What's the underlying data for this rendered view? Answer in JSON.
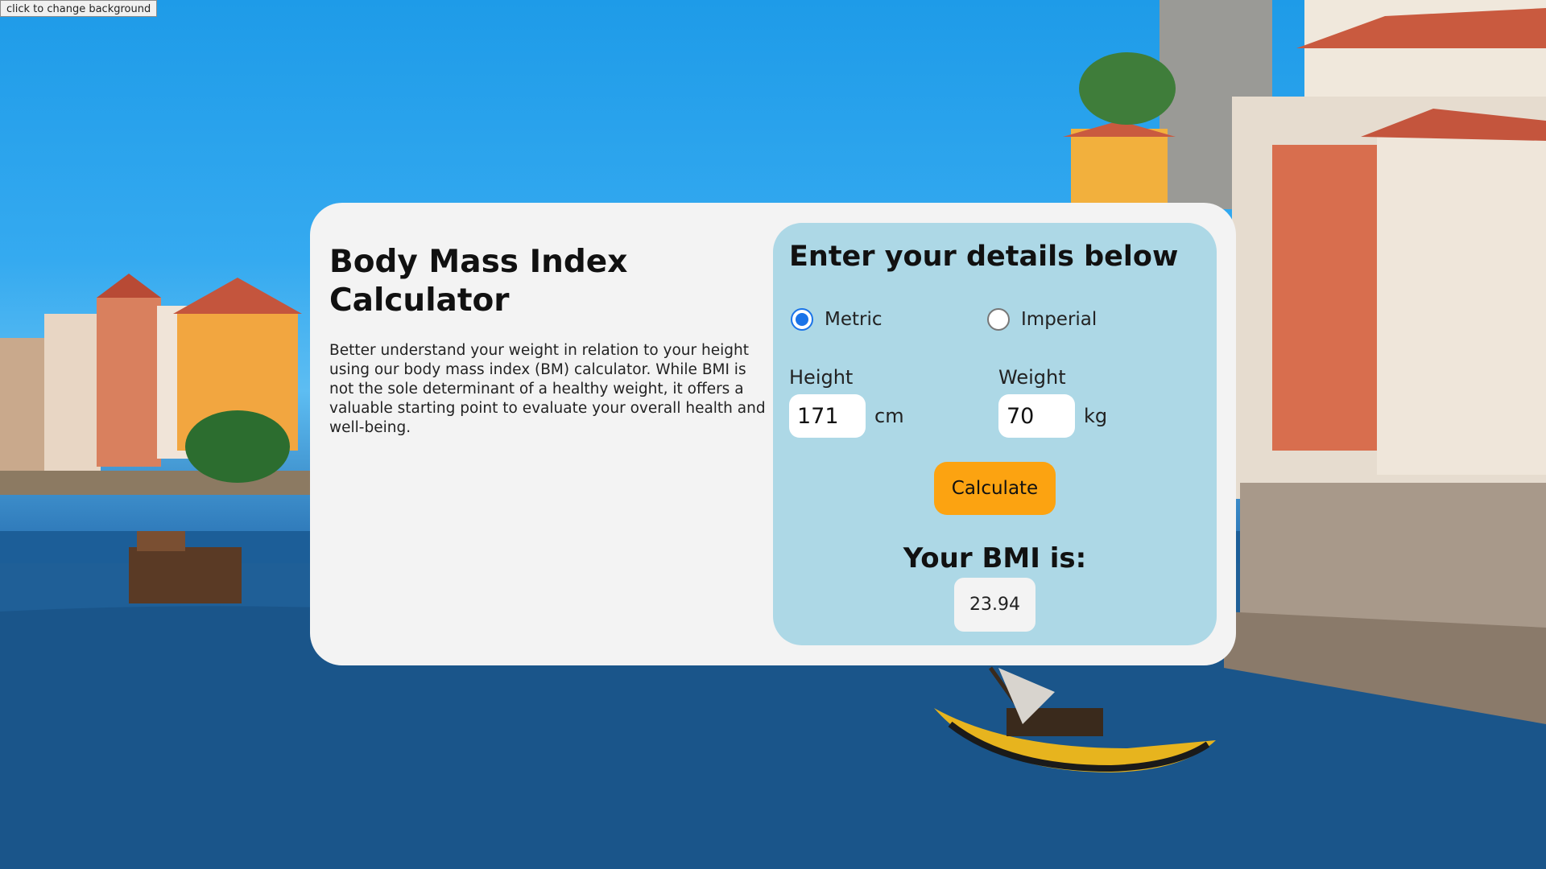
{
  "background_button": {
    "label": "click to change background"
  },
  "intro": {
    "title": "Body Mass Index Calculator",
    "description": "Better understand your weight in relation to your height using our body mass index (BM) calculator. While BMI is not the sole determinant of a healthy weight, it offers a valuable starting point to evaluate your overall health and well-being."
  },
  "form": {
    "heading": "Enter your details below",
    "units": [
      {
        "label": "Metric",
        "checked": true
      },
      {
        "label": "Imperial",
        "checked": false
      }
    ],
    "height": {
      "label": "Height",
      "value": "171",
      "unit": "cm"
    },
    "weight": {
      "label": "Weight",
      "value": "70",
      "unit": "kg"
    },
    "calculate_label": "Calculate"
  },
  "result": {
    "title": "Your BMI is:",
    "value": "23.94"
  },
  "colors": {
    "card": "#f3f3f3",
    "panel": "#add8e6",
    "button": "#fca311",
    "radio_checked": "#1a73e8"
  }
}
